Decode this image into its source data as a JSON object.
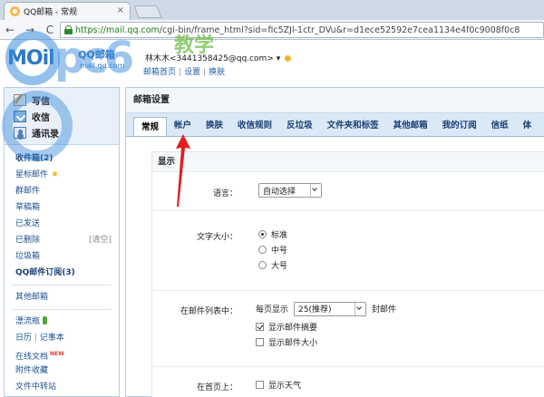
{
  "browser": {
    "tab_title": "QQ邮箱 - 常规",
    "tab_close": "×",
    "url_secure": "https://mail.qq.com",
    "url_rest": "/cgi-bin/frame_html?sid=fic5ZJl-1ctr_DVu&r=d1ece52592e7cea1134e4f0c9008f0c8",
    "back": "←",
    "forward": "→",
    "reload": "C"
  },
  "header": {
    "logo_mail": "MOil",
    "logo_qq": "QQ邮箱",
    "logo_sub": "mail.qq.com",
    "user_text": "林木木<3441358425@qq.com>",
    "user_suffix": "▾",
    "link_home": "邮箱首页",
    "link_settings": "设置",
    "link_skin": "换肤",
    "sep": "|"
  },
  "watermark": {
    "text": "pc6",
    "cn": "教学"
  },
  "sidebar": {
    "actions": [
      {
        "label": "写信",
        "icon": "pen-icon"
      },
      {
        "label": "收信",
        "icon": "inbox-icon"
      },
      {
        "label": "通讯录",
        "icon": "contacts-icon"
      }
    ],
    "folders": [
      {
        "label": "收件箱(2)",
        "bold": true
      },
      {
        "label": "星标邮件",
        "star": "★"
      },
      {
        "label": "群邮件"
      },
      {
        "label": "草稿箱"
      },
      {
        "label": "已发送"
      },
      {
        "label": "已删除",
        "aux": "[清空]"
      },
      {
        "label": "垃圾箱"
      },
      {
        "label": "QQ邮件订阅(3)",
        "bold": true
      }
    ],
    "other": "其他邮箱",
    "extras": [
      {
        "label": "漂流瓶"
      },
      {
        "label": "日历",
        "label2": "记事本"
      },
      {
        "label": "在线文档",
        "badge": "NEW"
      },
      {
        "label": "附件收藏"
      },
      {
        "label": "文件中转站"
      }
    ]
  },
  "main": {
    "title": "邮箱设置",
    "tabs": [
      "常规",
      "帐户",
      "换肤",
      "收信规则",
      "反垃圾",
      "文件夹和标签",
      "其他邮箱",
      "我的订阅",
      "信纸",
      "体"
    ],
    "active_tab": 0,
    "section_title": "显示",
    "language_label": "语言：",
    "language_value": "自动选择",
    "fontsize_label": "文字大小：",
    "fontsize_options": [
      "标准",
      "中号",
      "大号"
    ],
    "fontsize_selected": 0,
    "list_label": "在邮件列表中：",
    "per_page_prefix": "每页显示",
    "per_page_value": "25(推荐)",
    "per_page_suffix": "封邮件",
    "show_summary": "显示邮件摘要",
    "show_summary_checked": true,
    "show_size": "显示邮件大小",
    "show_size_checked": false,
    "homepage_label": "在首页上：",
    "show_weather": "显示天气",
    "show_weather_checked": false
  },
  "colors": {
    "accent": "#2d79c7",
    "arrow": "#e02020"
  }
}
